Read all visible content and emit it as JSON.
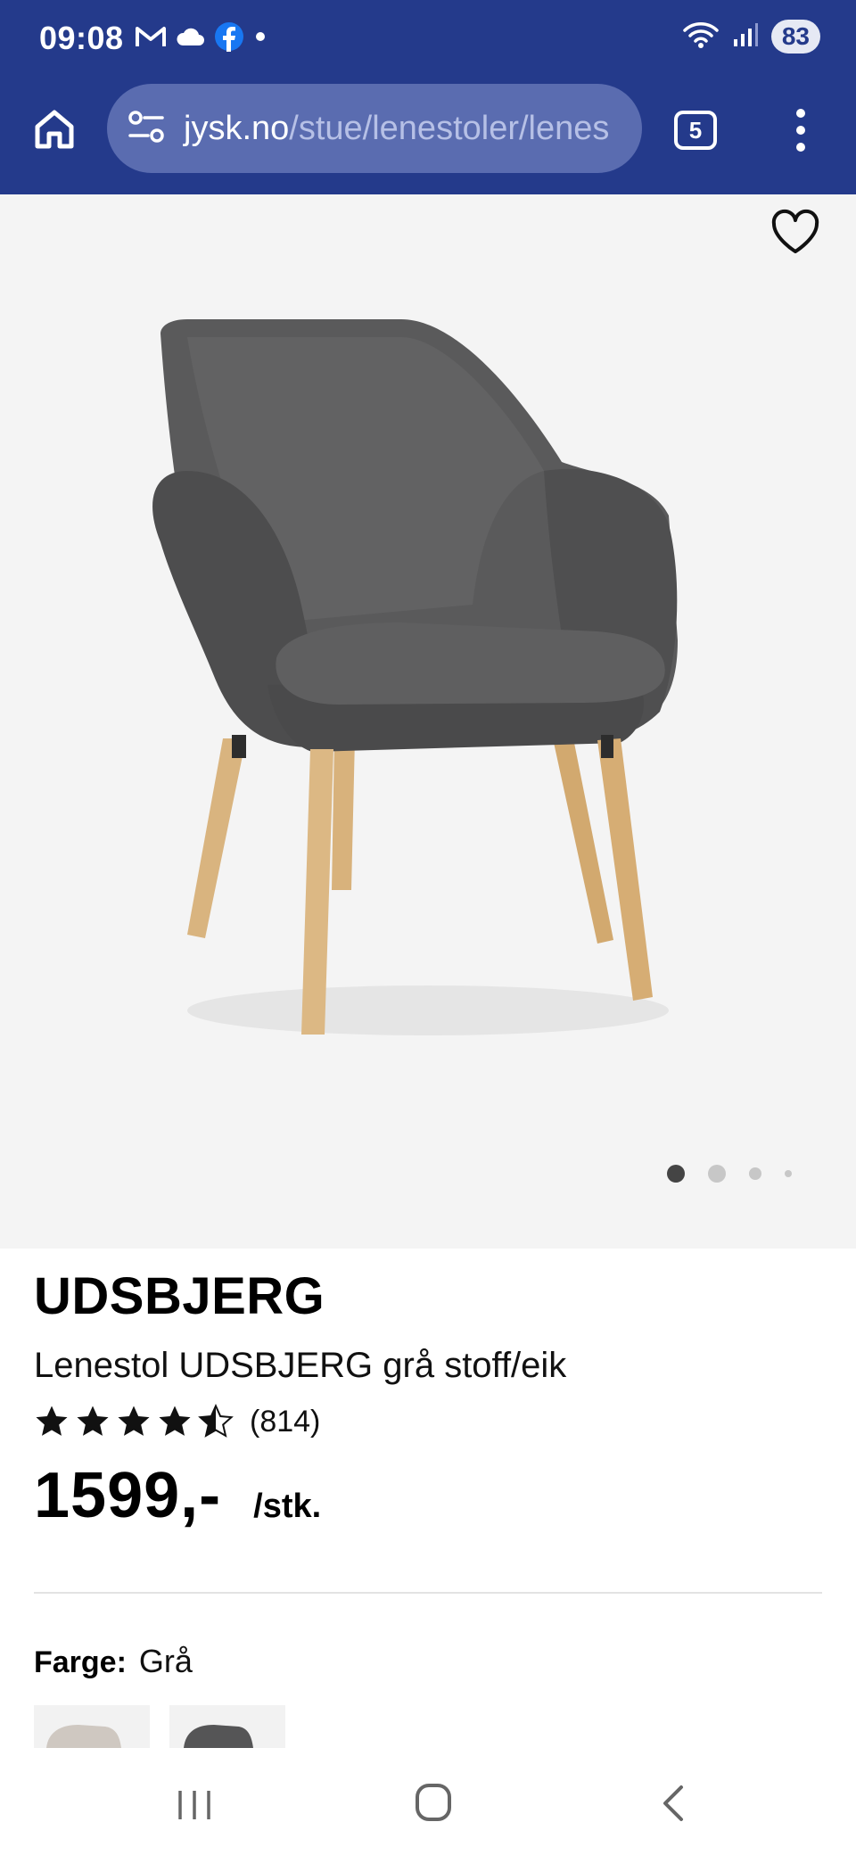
{
  "status_bar": {
    "time": "09:08",
    "battery": "83",
    "icons": [
      "gmail-icon",
      "cloud-icon",
      "facebook-icon",
      "dot-icon",
      "wifi-icon",
      "signal-icon"
    ]
  },
  "browser": {
    "url_domain": "jysk.no",
    "url_path": "/stue/lenestoler/lenes",
    "tab_count": "5",
    "accent": "#243a8b"
  },
  "gallery": {
    "image_alt": "Grey fabric armchair with oak legs",
    "total_images": 4,
    "active_index": 0
  },
  "product": {
    "brand": "UDSBJERG",
    "name": "Lenestol UDSBJERG grå stoff/eik",
    "rating": 4.5,
    "review_count": "(814)",
    "price": "1599,-",
    "unit": "/stk.",
    "color_label": "Farge:",
    "color_value": "Grå",
    "swatches": [
      "beige",
      "grey"
    ]
  },
  "system_nav": {
    "icons": [
      "recents-icon",
      "home-icon",
      "back-icon"
    ]
  }
}
